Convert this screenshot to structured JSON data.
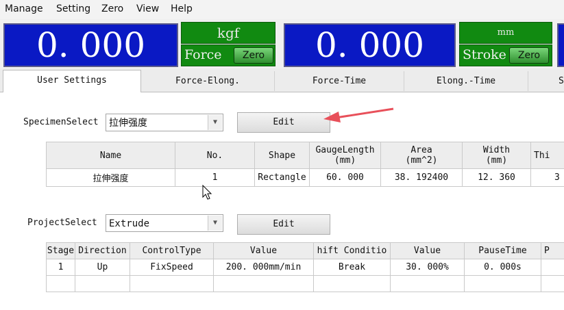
{
  "menu": [
    "Manage",
    "Setting",
    "Zero",
    "View",
    "Help"
  ],
  "force_display": {
    "value": "0. 000",
    "unit": "kgf",
    "label": "Force",
    "zero_label": "Zero"
  },
  "stroke_display": {
    "value": "0. 000",
    "unit": "mm",
    "label": "Stroke",
    "zero_label": "Zero"
  },
  "tabs": [
    "User Settings",
    "Force-Elong.",
    "Force-Time",
    "Elong.-Time",
    "S"
  ],
  "specimen": {
    "label": "SpecimenSelect",
    "value": "拉伸强度",
    "edit_label": "Edit",
    "columns": [
      "Name",
      "No.",
      "Shape",
      "GaugeLength\n(mm)",
      "Area\n(mm^2)",
      "Width\n(mm)",
      "Thi"
    ],
    "rows": [
      [
        "拉伸强度",
        "1",
        "Rectangle",
        "60. 000",
        "38. 192400",
        "12. 360",
        "3"
      ]
    ]
  },
  "project": {
    "label": "ProjectSelect",
    "value": "Extrude",
    "edit_label": "Edit",
    "columns": [
      "Stage",
      "Direction",
      "ControlType",
      "Value",
      "hift Conditio",
      "Value",
      "PauseTime",
      "P"
    ],
    "rows": [
      [
        "1",
        "Up",
        "FixSpeed",
        "200. 000mm/min",
        "Break",
        "30. 000%",
        "0. 000s",
        ""
      ]
    ]
  },
  "colors": {
    "display_bg": "#0a19c4",
    "unit_bg": "#118a11",
    "annotation_arrow": "#e8505a"
  }
}
